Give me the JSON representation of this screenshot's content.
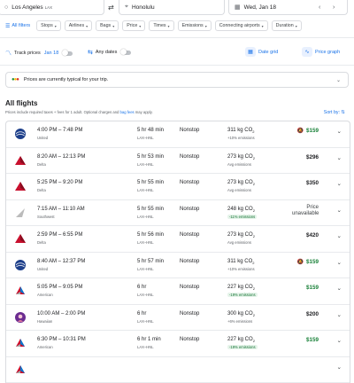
{
  "search": {
    "origin": "Los Angeles",
    "origin_code": "LAX",
    "destination": "Honolulu",
    "date": "Wed, Jan 18"
  },
  "filters": {
    "all_filters": "All filters",
    "chips": [
      "Stops",
      "Airlines",
      "Bags",
      "Price",
      "Times",
      "Emissions",
      "Connecting airports",
      "Duration"
    ]
  },
  "tools": {
    "track_prices": "Track prices",
    "track_date": "Jan 18",
    "any_dates": "Any dates",
    "date_grid": "Date grid",
    "price_graph": "Price graph"
  },
  "price_info": "Prices are currently typical for your trip.",
  "results": {
    "title": "All flights",
    "subtitle_prefix": "Prices include required taxes + fees for 1 adult. Optional charges and ",
    "subtitle_link": "bag fees",
    "subtitle_suffix": " may apply.",
    "sort_label": "Sort by:"
  },
  "flights": [
    {
      "times": "4:00 PM – 7:48 PM",
      "airline": "United",
      "duration": "5 hr 48 min",
      "route": "LAX–HNL",
      "stops": "Nonstop",
      "co2": "311 kg CO",
      "emissions": "+10% emissions",
      "em_green": false,
      "price": "$159",
      "price_style": "green",
      "lock": true,
      "logo": "united"
    },
    {
      "times": "8:20 AM – 12:13 PM",
      "airline": "Delta",
      "duration": "5 hr 53 min",
      "route": "LAX–HNL",
      "stops": "Nonstop",
      "co2": "273 kg CO",
      "emissions": "Avg emissions",
      "em_green": false,
      "price": "$296",
      "price_style": "normal",
      "lock": false,
      "logo": "delta"
    },
    {
      "times": "5:25 PM – 9:20 PM",
      "airline": "Delta",
      "duration": "5 hr 55 min",
      "route": "LAX–HNL",
      "stops": "Nonstop",
      "co2": "273 kg CO",
      "emissions": "Avg emissions",
      "em_green": false,
      "price": "$350",
      "price_style": "normal",
      "lock": false,
      "logo": "delta"
    },
    {
      "times": "7:15 AM – 11:10 AM",
      "airline": "Southwest",
      "duration": "5 hr 55 min",
      "route": "LAX–HNL",
      "stops": "Nonstop",
      "co2": "248 kg CO",
      "emissions": "-11% emissions",
      "em_green": true,
      "price": "Price unavailable",
      "price_style": "gray",
      "lock": false,
      "logo": "southwest"
    },
    {
      "times": "2:59 PM – 6:55 PM",
      "airline": "Delta",
      "duration": "5 hr 56 min",
      "route": "LAX–HNL",
      "stops": "Nonstop",
      "co2": "273 kg CO",
      "emissions": "Avg emissions",
      "em_green": false,
      "price": "$420",
      "price_style": "normal",
      "lock": false,
      "logo": "delta"
    },
    {
      "times": "8:40 AM – 12:37 PM",
      "airline": "United",
      "duration": "5 hr 57 min",
      "route": "LAX–HNL",
      "stops": "Nonstop",
      "co2": "311 kg CO",
      "emissions": "+10% emissions",
      "em_green": false,
      "price": "$159",
      "price_style": "green",
      "lock": true,
      "logo": "united"
    },
    {
      "times": "5:05 PM – 9:05 PM",
      "airline": "American",
      "duration": "6 hr",
      "route": "LAX–HNL",
      "stops": "Nonstop",
      "co2": "227 kg CO",
      "emissions": "-19% emissions",
      "em_green": true,
      "price": "$159",
      "price_style": "green",
      "lock": false,
      "logo": "american"
    },
    {
      "times": "10:00 AM – 2:00 PM",
      "airline": "Hawaiian",
      "duration": "6 hr",
      "route": "LAX–HNL",
      "stops": "Nonstop",
      "co2": "300 kg CO",
      "emissions": "+6% emissions",
      "em_green": false,
      "price": "$200",
      "price_style": "normal",
      "lock": false,
      "logo": "hawaiian"
    },
    {
      "times": "6:30 PM – 10:31 PM",
      "airline": "American",
      "duration": "6 hr 1 min",
      "route": "LAX–HNL",
      "stops": "Nonstop",
      "co2": "227 kg CO",
      "emissions": "-19% emissions",
      "em_green": true,
      "price": "$159",
      "price_style": "green",
      "lock": false,
      "logo": "american"
    },
    {
      "times": "",
      "airline": "",
      "duration": "",
      "route": "",
      "stops": "",
      "co2": "",
      "emissions": "",
      "em_green": false,
      "price": "",
      "price_style": "normal",
      "lock": false,
      "logo": "american"
    }
  ]
}
